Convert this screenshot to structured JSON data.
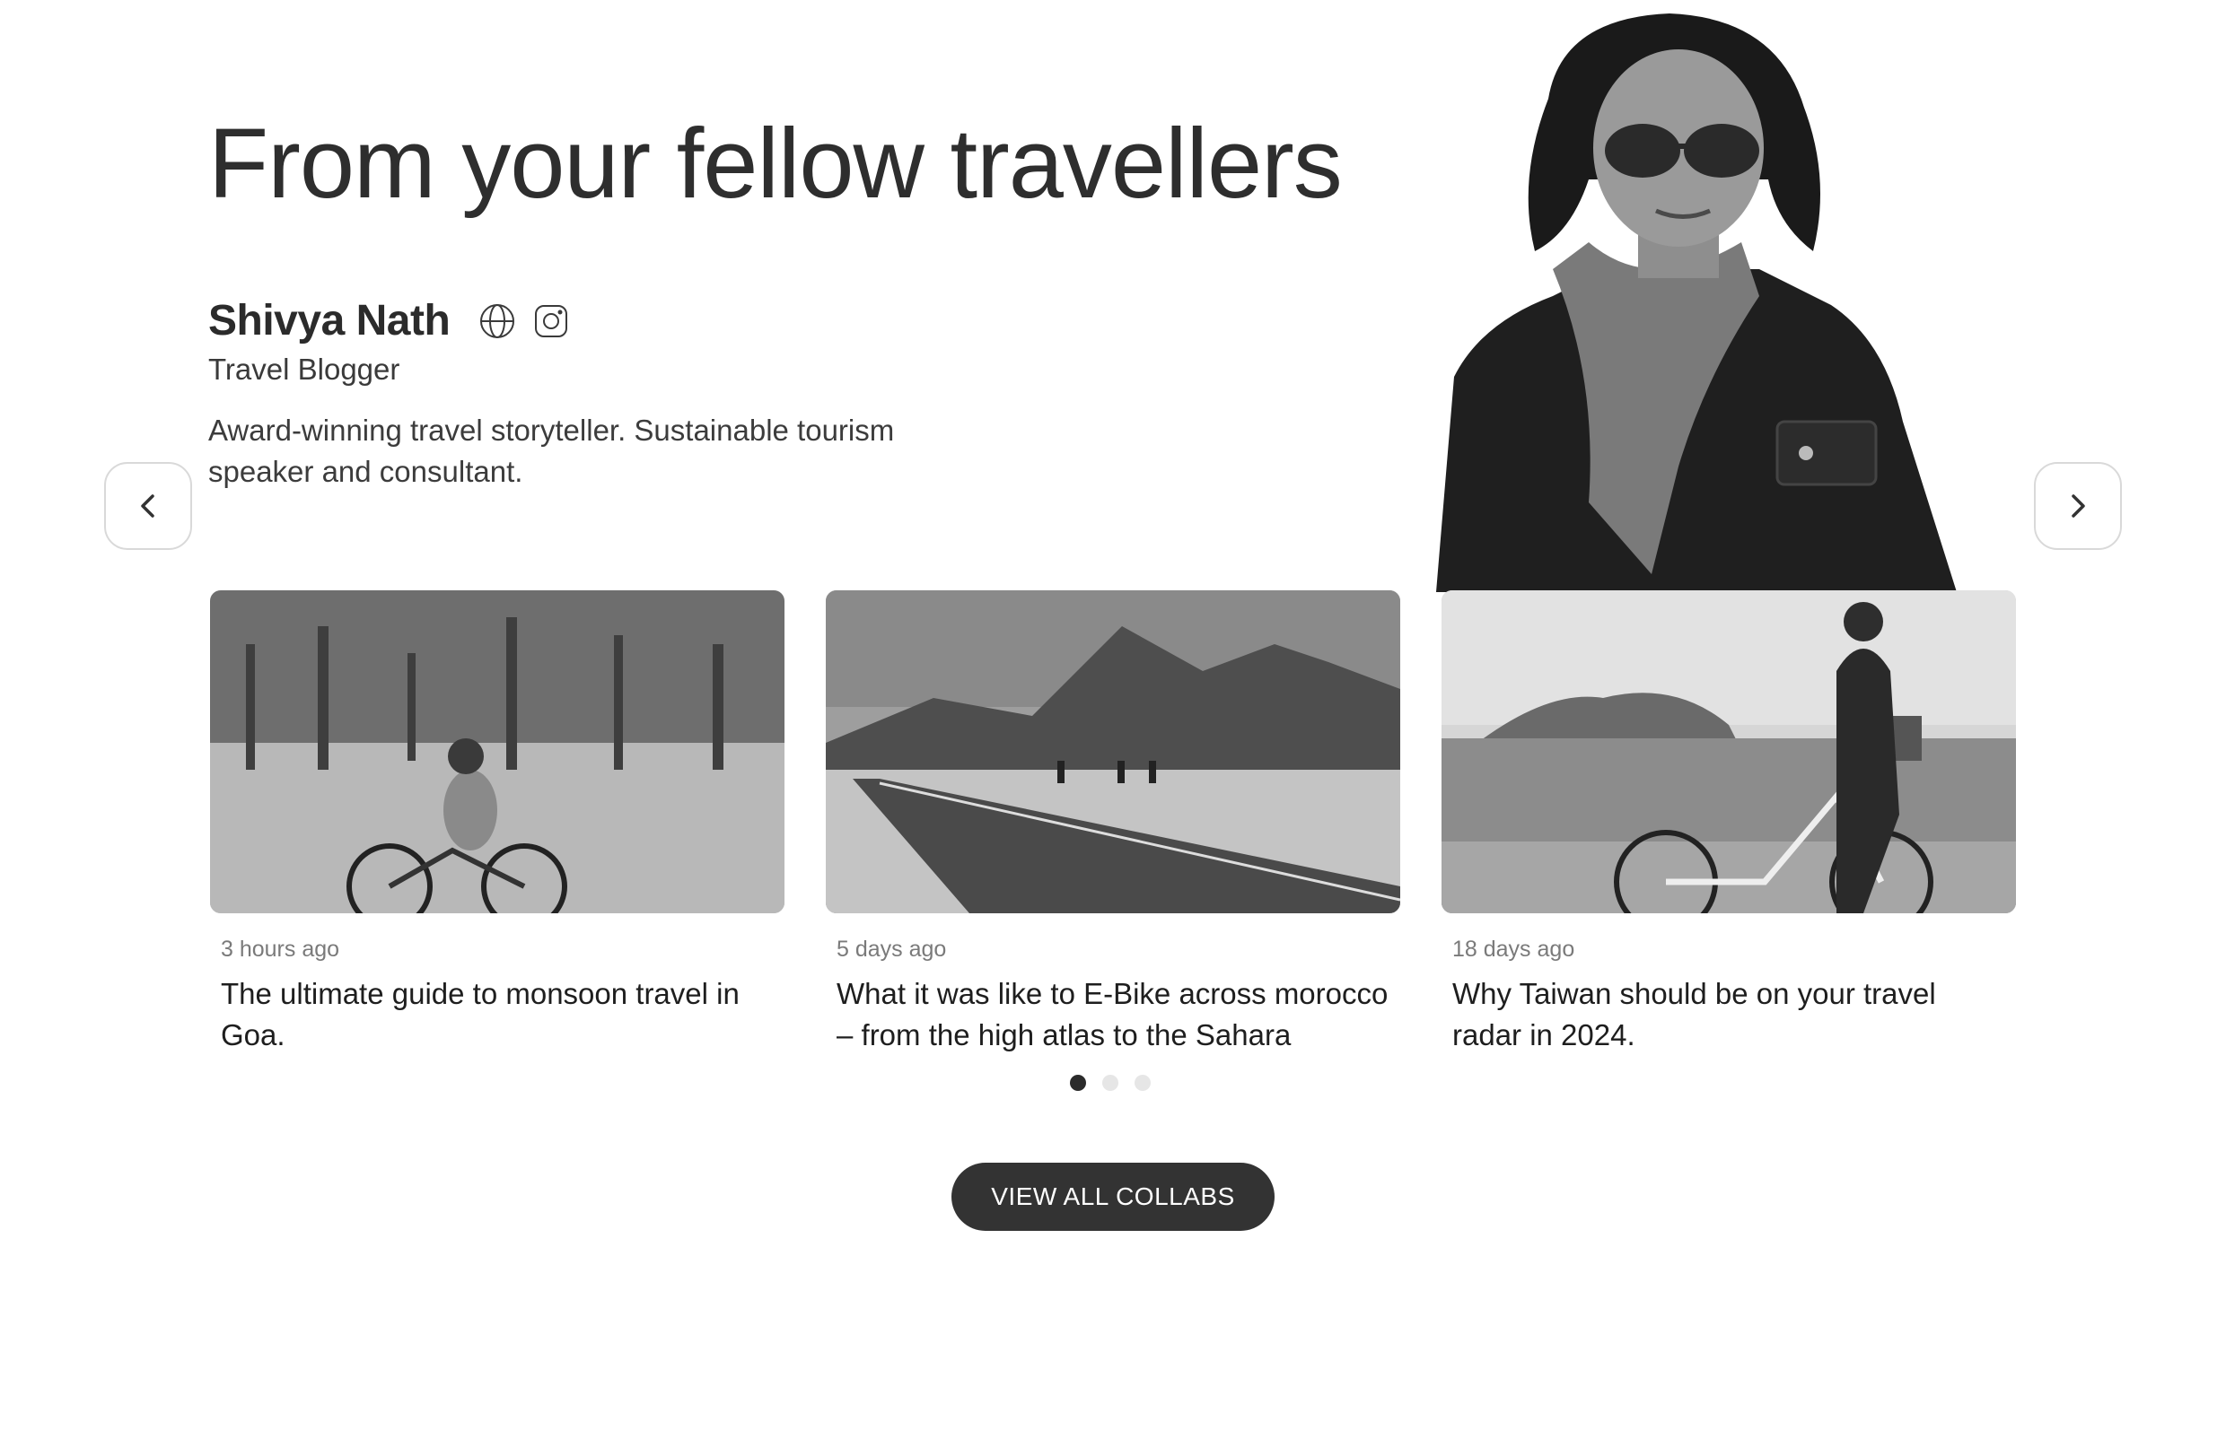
{
  "section": {
    "title": "From your fellow travellers"
  },
  "author": {
    "name": "Shivya Nath",
    "role": "Travel Blogger",
    "bio": "Award-winning travel storyteller. Sustainable tourism speaker and consultant.",
    "social_icons": [
      "globe-icon",
      "instagram-icon"
    ]
  },
  "carousel": {
    "prev_icon": "chevron-left-icon",
    "next_icon": "chevron-right-icon",
    "cards": [
      {
        "time": "3 hours ago",
        "title": "The ultimate guide to monsoon travel in Goa."
      },
      {
        "time": "5 days ago",
        "title": "What it was like to E-Bike across morocco – from the high atlas to the Sahara"
      },
      {
        "time": "18 days ago",
        "title": "Why Taiwan should be on your travel radar in 2024."
      }
    ],
    "pagination": {
      "total": 3,
      "active": 1
    }
  },
  "cta": {
    "label": "VIEW ALL COLLABS"
  },
  "colors": {
    "text": "#2b2b2b",
    "button_bg": "#333333",
    "dot_active": "#2b2b2b",
    "dot_inactive": "#e6e6e6"
  }
}
